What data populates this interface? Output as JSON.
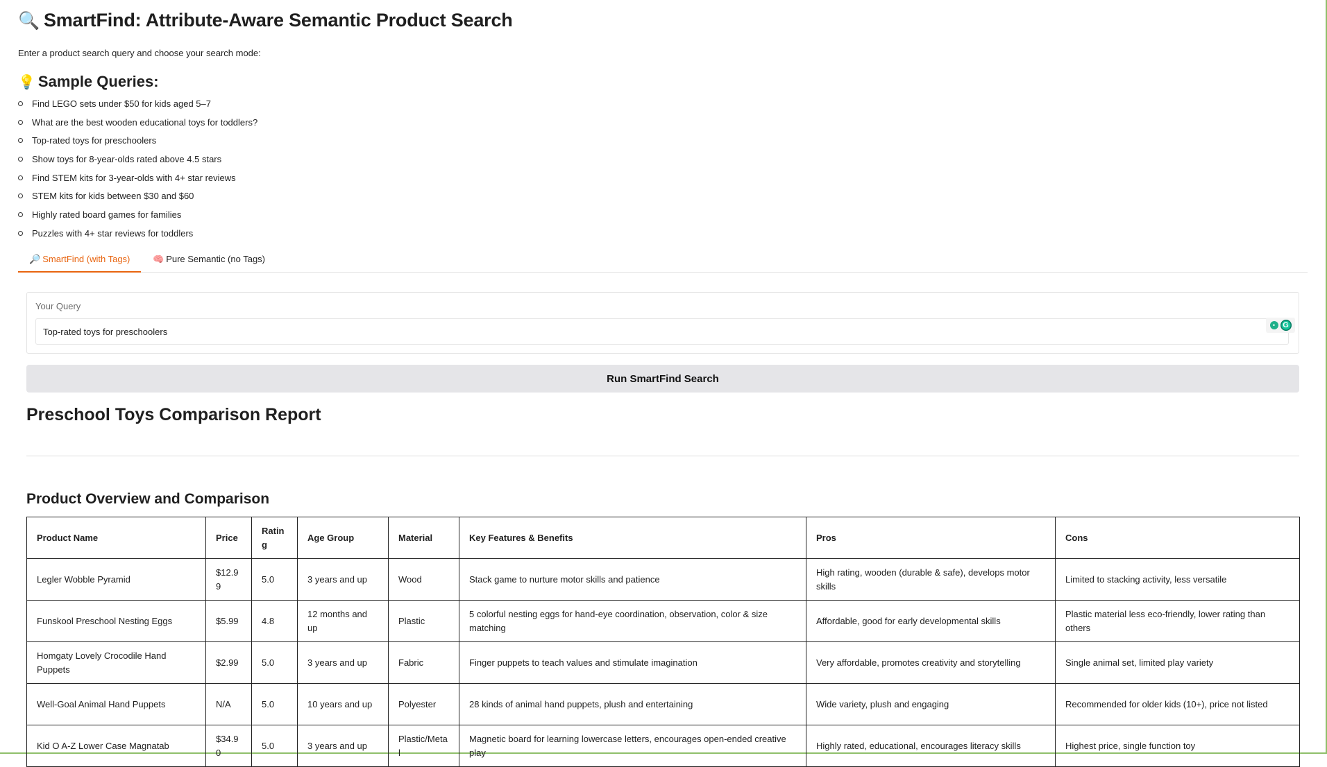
{
  "header": {
    "title_emoji": "🔍",
    "title": "SmartFind: Attribute-Aware Semantic Product Search",
    "intro": "Enter a product search query and choose your search mode:"
  },
  "samples": {
    "heading_emoji": "💡",
    "heading": "Sample Queries:",
    "items": [
      "Find LEGO sets under $50 for kids aged 5–7",
      "What are the best wooden educational toys for toddlers?",
      "Top-rated toys for preschoolers",
      "Show toys for 8-year-olds rated above 4.5 stars",
      "Find STEM kits for 3-year-olds with 4+ star reviews",
      "STEM kits for kids between $30 and $60",
      "Highly rated board games for families",
      "Puzzles with 4+ star reviews for toddlers"
    ]
  },
  "tabs": [
    {
      "emoji": "🔎",
      "label": "SmartFind (with Tags)",
      "active": true
    },
    {
      "emoji": "🧠",
      "label": "Pure Semantic (no Tags)",
      "active": false
    }
  ],
  "query": {
    "label": "Your Query",
    "value": "Top-rated toys for preschoolers"
  },
  "run_button": "Run SmartFind Search",
  "report": {
    "title": "Preschool Toys Comparison Report",
    "section_title": "Product Overview and Comparison",
    "columns": [
      "Product Name",
      "Price",
      "Rating",
      "Age Group",
      "Material",
      "Key Features & Benefits",
      "Pros",
      "Cons"
    ],
    "rows": [
      [
        "Legler Wobble Pyramid",
        "$12.99",
        "5.0",
        "3 years and up",
        "Wood",
        "Stack game to nurture motor skills and patience",
        "High rating, wooden (durable & safe), develops motor skills",
        "Limited to stacking activity, less versatile"
      ],
      [
        "Funskool Preschool Nesting Eggs",
        "$5.99",
        "4.8",
        "12 months and up",
        "Plastic",
        "5 colorful nesting eggs for hand-eye coordination, observation, color & size matching",
        "Affordable, good for early developmental skills",
        "Plastic material less eco-friendly, lower rating than others"
      ],
      [
        "Homgaty Lovely Crocodile Hand Puppets",
        "$2.99",
        "5.0",
        "3 years and up",
        "Fabric",
        "Finger puppets to teach values and stimulate imagination",
        "Very affordable, promotes creativity and storytelling",
        "Single animal set, limited play variety"
      ],
      [
        "Well-Goal Animal Hand Puppets",
        "N/A",
        "5.0",
        "10 years and up",
        "Polyester",
        "28 kinds of animal hand puppets, plush and entertaining",
        "Wide variety, plush and engaging",
        "Recommended for older kids (10+), price not listed"
      ],
      [
        "Kid O A-Z Lower Case Magnatab",
        "$34.90",
        "5.0",
        "3 years and up",
        "Plastic/Metal",
        "Magnetic board for learning lowercase letters, encourages open-ended creative play",
        "Highly rated, educational, encourages literacy skills",
        "Highest price, single function toy"
      ]
    ]
  },
  "colors": {
    "accent": "#e8640f",
    "button_bg": "#e5e5e8",
    "frame": "#8fbf6a"
  }
}
